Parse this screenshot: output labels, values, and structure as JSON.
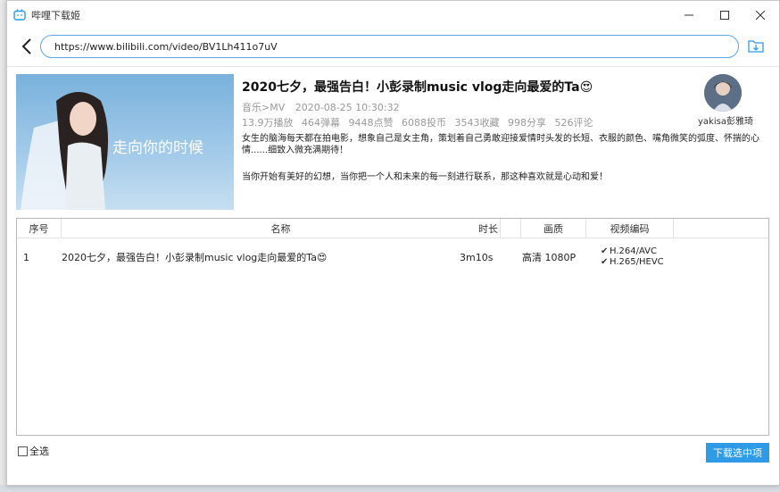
{
  "window": {
    "title": "哔哩下载姬",
    "minimize": "—",
    "maximize": "☐",
    "close": "✕"
  },
  "address": {
    "url": "https://www.bilibili.com/video/BV1Lh411o7uV"
  },
  "video": {
    "title": "2020七夕，最强告白！小彭录制music vlog走向最爱的Ta😍",
    "category": "音乐>MV",
    "date": "2020-08-25 10:30:32",
    "stats": [
      "13.9万播放",
      "464弹幕",
      "9448点赞",
      "6088投币",
      "3543收藏",
      "998分享",
      "526评论"
    ],
    "description1": "女生的脑海每天都在拍电影，想象自己是女主角，策划着自己勇敢迎接爱情时头发的长短、衣服的颜色、嘴角微笑的弧度、怀揣的心情......细致入微充满期待！",
    "description2": "当你开始有美好的幻想，当你把一个人和未来的每一刻进行联系，那这种喜欢就是心动和爱！",
    "thumbnail_text": "走向你的时候",
    "uploader": "yakisa彭雅琦"
  },
  "table": {
    "headers": [
      "序号",
      "名称",
      "时长",
      "画质",
      "视频编码"
    ],
    "rows": [
      {
        "index": "1",
        "name": "2020七夕，最强告白！小彭录制music vlog走向最爱的Ta😍",
        "duration": "3m10s",
        "quality": "高清 1080P",
        "codecs": [
          "H.264/AVC",
          "H.265/HEVC"
        ]
      }
    ]
  },
  "footer": {
    "select_all": "全选",
    "download_selected": "下载选中项"
  },
  "colors": {
    "accent": "#2f9be6",
    "url_border": "#5aa6e6"
  }
}
